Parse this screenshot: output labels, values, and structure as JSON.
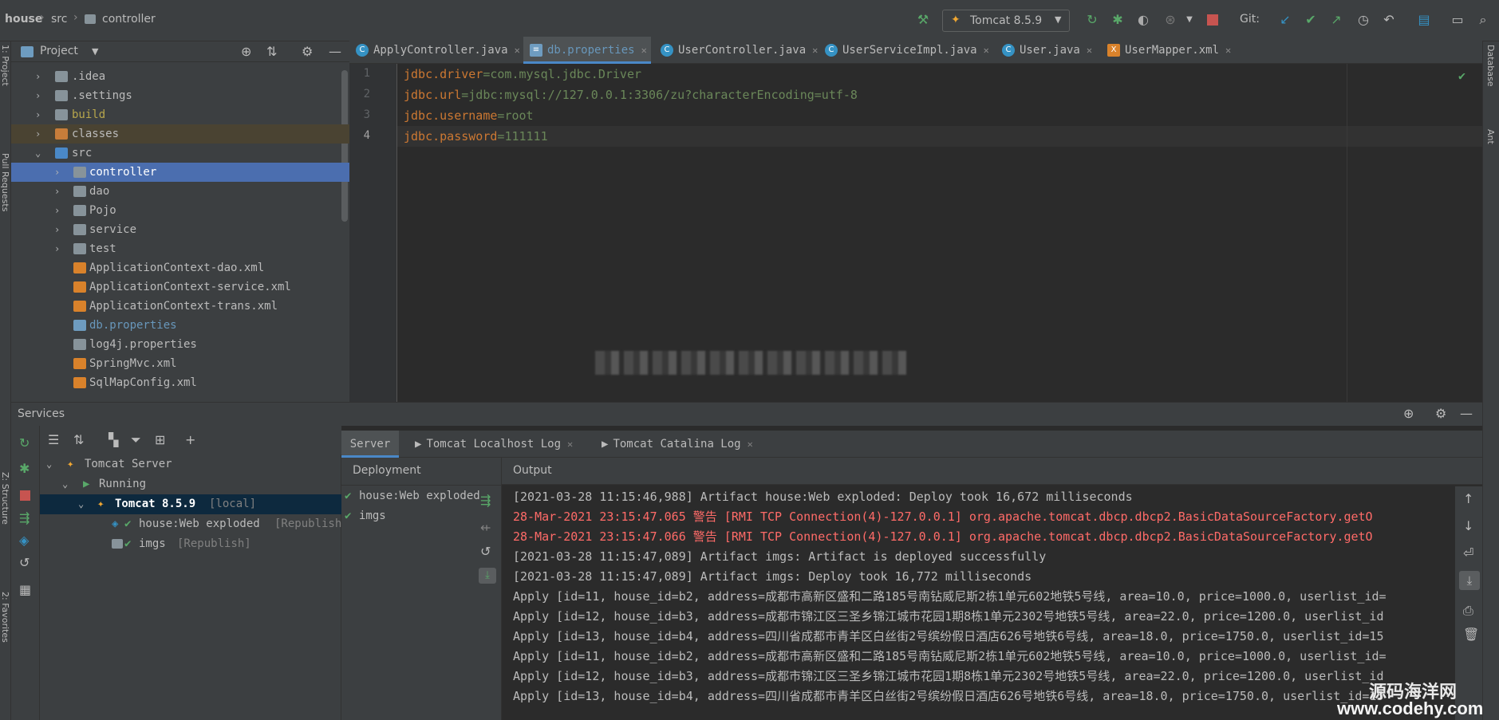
{
  "breadcrumb": {
    "project": "house",
    "folder": "src",
    "package": "controller"
  },
  "toolbar": {
    "run_config": "Tomcat 8.5.9",
    "git_label": "Git:"
  },
  "left_strip": {
    "project_tab": "1: Project",
    "pull_requests_tab": "Pull Requests",
    "structure_tab": "Z: Structure",
    "favorites_tab": "2: Favorites"
  },
  "right_strip": {
    "database_tab": "Database",
    "ant_tab": "Ant"
  },
  "project_panel": {
    "title": "Project",
    "items": [
      {
        "label": ".idea",
        "type": "folder"
      },
      {
        "label": ".settings",
        "type": "folder"
      },
      {
        "label": "build",
        "type": "folder"
      },
      {
        "label": "classes",
        "type": "folder"
      },
      {
        "label": "src",
        "type": "folder"
      },
      {
        "label": "controller",
        "type": "package"
      },
      {
        "label": "dao",
        "type": "package"
      },
      {
        "label": "Pojo",
        "type": "package"
      },
      {
        "label": "service",
        "type": "package"
      },
      {
        "label": "test",
        "type": "package"
      },
      {
        "label": "ApplicationContext-dao.xml",
        "type": "xml"
      },
      {
        "label": "ApplicationContext-service.xml",
        "type": "xml"
      },
      {
        "label": "ApplicationContext-trans.xml",
        "type": "xml"
      },
      {
        "label": "db.properties",
        "type": "properties"
      },
      {
        "label": "log4j.properties",
        "type": "properties"
      },
      {
        "label": "SpringMvc.xml",
        "type": "xml"
      },
      {
        "label": "SqlMapConfig.xml",
        "type": "xml"
      }
    ]
  },
  "editor": {
    "tabs": [
      {
        "label": "ApplyController.java",
        "active": false
      },
      {
        "label": "db.properties",
        "active": true
      },
      {
        "label": "UserController.java",
        "active": false
      },
      {
        "label": "UserServiceImpl.java",
        "active": false
      },
      {
        "label": "User.java",
        "active": false
      },
      {
        "label": "UserMapper.xml",
        "active": false
      }
    ],
    "lines": [
      {
        "no": "1",
        "key": "jdbc.driver",
        "value": "com.mysql.jdbc.Driver"
      },
      {
        "no": "2",
        "key": "jdbc.url",
        "value": "jdbc:mysql://127.0.0.1:3306/zu?characterEncoding=utf-8"
      },
      {
        "no": "3",
        "key": "jdbc.username",
        "value": "root"
      },
      {
        "no": "4",
        "key": "jdbc.password",
        "value": "111111"
      }
    ]
  },
  "services": {
    "title": "Services",
    "tree": {
      "server": "Tomcat Server",
      "status": "Running",
      "instance": "Tomcat 8.5.9",
      "instance_tag": "[local]",
      "artifacts": [
        {
          "name": "house:Web exploded",
          "tag": "[Republish]"
        },
        {
          "name": "imgs",
          "tag": "[Republish]"
        }
      ]
    },
    "tabs": [
      "Server",
      "Tomcat Localhost Log",
      "Tomcat Catalina Log"
    ],
    "deployment_header": "Deployment",
    "deployment": [
      "house:Web exploded",
      "imgs"
    ],
    "output_header": "Output",
    "log_lines": [
      {
        "text": "[2021-03-28 11:15:46,988] Artifact house:Web exploded: Deploy took 16,672 milliseconds",
        "level": "info"
      },
      {
        "text": "28-Mar-2021 23:15:47.065 警告 [RMI TCP Connection(4)-127.0.0.1] org.apache.tomcat.dbcp.dbcp2.BasicDataSourceFactory.getO",
        "level": "warn"
      },
      {
        "text": "28-Mar-2021 23:15:47.066 警告 [RMI TCP Connection(4)-127.0.0.1] org.apache.tomcat.dbcp.dbcp2.BasicDataSourceFactory.getO",
        "level": "warn"
      },
      {
        "text": "[2021-03-28 11:15:47,089] Artifact imgs: Artifact is deployed successfully",
        "level": "info"
      },
      {
        "text": "[2021-03-28 11:15:47,089] Artifact imgs: Deploy took 16,772 milliseconds",
        "level": "info"
      },
      {
        "text": "Apply [id=11, house_id=b2, address=成都市高新区盛和二路185号南钻威尼斯2栋1单元602地铁5号线, area=10.0, price=1000.0, userlist_id=",
        "level": "info"
      },
      {
        "text": "Apply [id=12, house_id=b3, address=成都市锦江区三圣乡锦江城市花园1期8栋1单元2302号地铁5号线, area=22.0, price=1200.0, userlist_id",
        "level": "info"
      },
      {
        "text": "Apply [id=13, house_id=b4, address=四川省成都市青羊区白丝街2号缤纷假日酒店626号地铁6号线, area=18.0, price=1750.0, userlist_id=15",
        "level": "info"
      },
      {
        "text": "Apply [id=11, house_id=b2, address=成都市高新区盛和二路185号南钻威尼斯2栋1单元602地铁5号线, area=10.0, price=1000.0, userlist_id=",
        "level": "info"
      },
      {
        "text": "Apply [id=12, house_id=b3, address=成都市锦江区三圣乡锦江城市花园1期8栋1单元2302号地铁5号线, area=22.0, price=1200.0, userlist_id",
        "level": "info"
      },
      {
        "text": "Apply [id=13, house_id=b4, address=四川省成都市青羊区白丝街2号缤纷假日酒店626号地铁6号线, area=18.0, price=1750.0, userlist_id=15",
        "level": "info"
      }
    ]
  },
  "watermark": {
    "text": "源码海洋网",
    "url": "www.codehy.com"
  },
  "colors": {
    "selection": "#4b6eaf",
    "keyword": "#cc7832",
    "string": "#6a8759",
    "warning": "#ff6b68",
    "success": "#59a869"
  }
}
